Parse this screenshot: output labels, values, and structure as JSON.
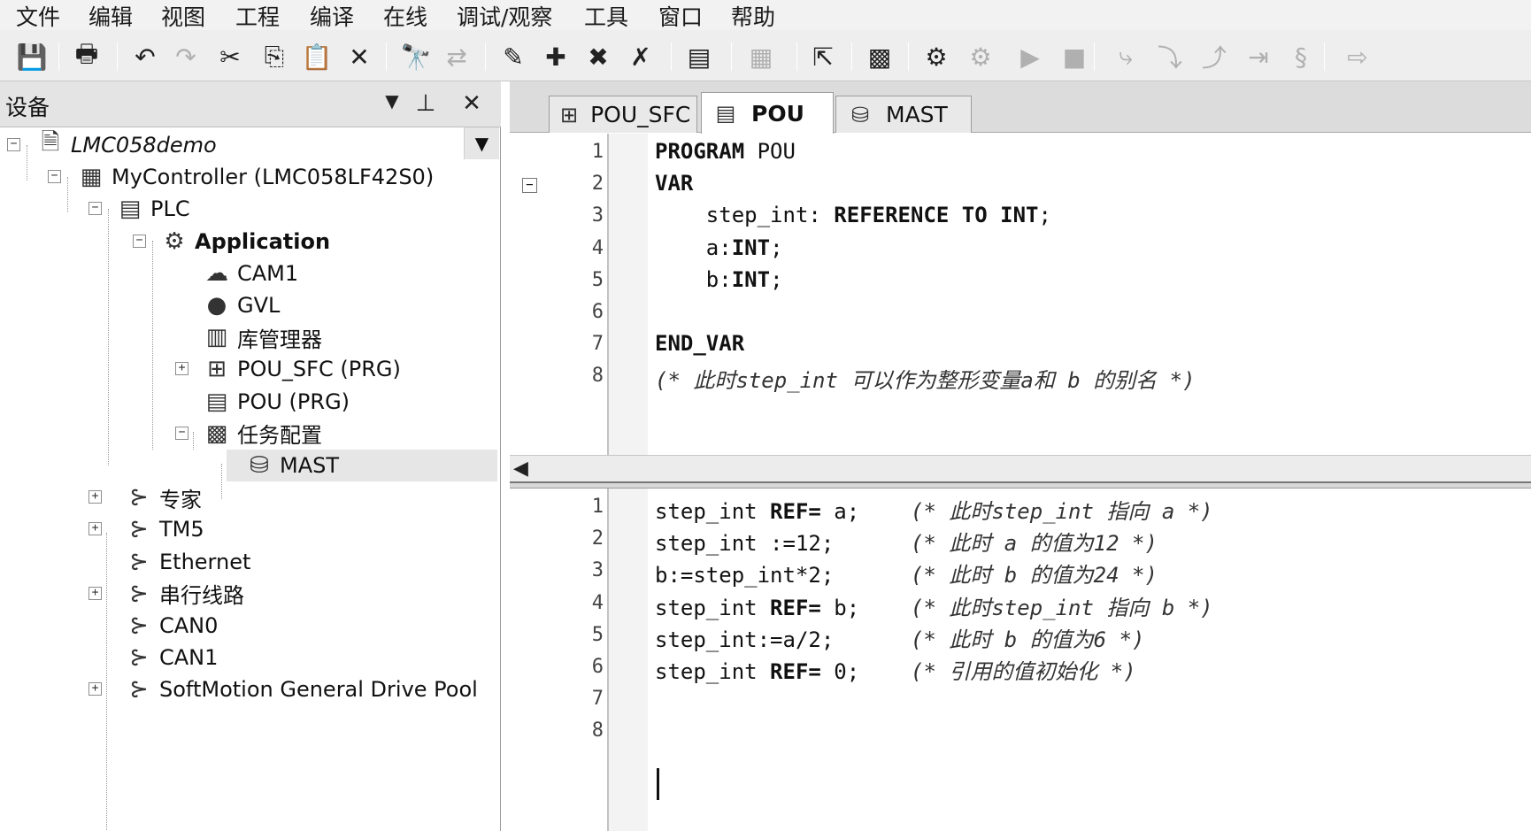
{
  "menu": [
    "文件",
    "编辑",
    "视图",
    "工程",
    "编译",
    "在线",
    "调试/观察",
    "工具",
    "窗口",
    "帮助"
  ],
  "toolbar": {
    "icons": [
      {
        "name": "save-icon",
        "glyph": "💾",
        "enabled": true
      },
      {
        "name": "print-icon",
        "glyph": "🖶",
        "enabled": true
      },
      {
        "name": "undo-icon",
        "glyph": "↶",
        "enabled": true
      },
      {
        "name": "redo-icon",
        "glyph": "↷",
        "enabled": false
      },
      {
        "name": "cut-icon",
        "glyph": "✂",
        "enabled": true
      },
      {
        "name": "copy-icon",
        "glyph": "⎘",
        "enabled": true
      },
      {
        "name": "paste-icon",
        "glyph": "📋",
        "enabled": true
      },
      {
        "name": "delete-icon",
        "glyph": "✕",
        "enabled": true
      },
      {
        "name": "find-icon",
        "glyph": "🔭",
        "enabled": true
      },
      {
        "name": "replace-icon",
        "glyph": "⇄",
        "enabled": false
      },
      {
        "name": "breakpoint-icon",
        "glyph": "✎",
        "enabled": true
      },
      {
        "name": "breakpoint-add-icon",
        "glyph": "✚",
        "enabled": true
      },
      {
        "name": "breakpoint-remove-icon",
        "glyph": "✖",
        "enabled": true
      },
      {
        "name": "breakpoint-toggle-icon",
        "glyph": "✗",
        "enabled": true
      },
      {
        "name": "device-icon",
        "glyph": "▤",
        "enabled": true
      },
      {
        "name": "insert-dropdown-icon",
        "glyph": "▦",
        "enabled": false
      },
      {
        "name": "export-icon",
        "glyph": "⇱",
        "enabled": true
      },
      {
        "name": "build-icon",
        "glyph": "▩",
        "enabled": true
      },
      {
        "name": "login-icon",
        "glyph": "⚙",
        "enabled": true
      },
      {
        "name": "logout-icon",
        "glyph": "⚙",
        "enabled": false
      },
      {
        "name": "run-icon",
        "glyph": "▶",
        "enabled": false
      },
      {
        "name": "stop-icon",
        "glyph": "■",
        "enabled": false
      },
      {
        "name": "step-over-icon",
        "glyph": "⤷",
        "enabled": false
      },
      {
        "name": "step-into-icon",
        "glyph": "⤵",
        "enabled": false
      },
      {
        "name": "step-out-icon",
        "glyph": "⤴",
        "enabled": false
      },
      {
        "name": "run-to-cursor-icon",
        "glyph": "⇥",
        "enabled": false
      },
      {
        "name": "reset-icon",
        "glyph": "§",
        "enabled": false
      },
      {
        "name": "next-statement-icon",
        "glyph": "⇨",
        "enabled": false
      }
    ]
  },
  "device_panel": {
    "title": "设备",
    "dropdown_glyph": "▼",
    "pin_glyph": "⊥",
    "close_glyph": "✕",
    "tree": [
      {
        "label": "LMC058demo",
        "icon": "project-icon",
        "glyph": "🗎",
        "toggle": "−",
        "style": "italic"
      },
      {
        "label": "MyController (LMC058LF42S0)",
        "icon": "controller-icon",
        "glyph": "▦",
        "toggle": "−",
        "style": "normal"
      },
      {
        "label": "PLC",
        "icon": "plc-logic-icon",
        "glyph": "▤",
        "toggle": "−",
        "style": "normal"
      },
      {
        "label": "Application",
        "icon": "application-gear-icon",
        "glyph": "⚙",
        "toggle": "−",
        "style": "bold"
      },
      {
        "label": "CAM1",
        "icon": "cam-icon",
        "glyph": "☁",
        "toggle": "",
        "style": "normal"
      },
      {
        "label": "GVL",
        "icon": "gvl-globe-icon",
        "glyph": "●",
        "toggle": "",
        "style": "normal"
      },
      {
        "label": "库管理器",
        "icon": "library-manager-icon",
        "glyph": "▥",
        "toggle": "",
        "style": "normal"
      },
      {
        "label": "POU_SFC (PRG)",
        "icon": "sfc-pou-icon",
        "glyph": "⊞",
        "toggle": "+",
        "style": "normal"
      },
      {
        "label": "POU (PRG)",
        "icon": "pou-document-icon",
        "glyph": "▤",
        "toggle": "",
        "style": "normal"
      },
      {
        "label": "任务配置",
        "icon": "task-config-icon",
        "glyph": "▩",
        "toggle": "−",
        "style": "normal"
      },
      {
        "label": "MAST",
        "icon": "task-mast-icon",
        "glyph": "⛁",
        "toggle": "",
        "style": "normal"
      },
      {
        "label": "专家",
        "icon": "expert-connector-icon",
        "glyph": "⊱",
        "toggle": "+",
        "style": "normal"
      },
      {
        "label": "TM5",
        "icon": "tm5-connector-icon",
        "glyph": "⊱",
        "toggle": "+",
        "style": "normal"
      },
      {
        "label": "Ethernet",
        "icon": "ethernet-connector-icon",
        "glyph": "⊱",
        "toggle": "",
        "style": "normal"
      },
      {
        "label": "串行线路",
        "icon": "serial-line-connector-icon",
        "glyph": "⊱",
        "toggle": "+",
        "style": "normal"
      },
      {
        "label": "CAN0",
        "icon": "can0-connector-icon",
        "glyph": "⊱",
        "toggle": "",
        "style": "normal"
      },
      {
        "label": "CAN1",
        "icon": "can1-connector-icon",
        "glyph": "⊱",
        "toggle": "",
        "style": "normal"
      },
      {
        "label": "SoftMotion General Drive Pool",
        "icon": "drive-pool-connector-icon",
        "glyph": "⊱",
        "toggle": "+",
        "style": "normal"
      }
    ],
    "selected_index": 10
  },
  "editor": {
    "tabs": [
      {
        "label": "POU_SFC",
        "icon": "sfc-pou-icon",
        "glyph": "⊞",
        "active": false
      },
      {
        "label": "POU",
        "icon": "pou-document-icon",
        "glyph": "▤",
        "active": true
      },
      {
        "label": "MAST",
        "icon": "task-mast-icon",
        "glyph": "⛁",
        "active": false
      }
    ],
    "declaration": {
      "line_numbers": [
        "1",
        "2",
        "3",
        "4",
        "5",
        "6",
        "7",
        "8"
      ],
      "fold_glyph": "−",
      "lines": [
        [
          {
            "t": "PROGRAM",
            "k": "kw"
          },
          {
            "t": " POU",
            "k": ""
          }
        ],
        [
          {
            "t": "VAR",
            "k": "kw"
          }
        ],
        [
          {
            "t": "    step_int: ",
            "k": ""
          },
          {
            "t": "REFERENCE TO INT",
            "k": "kw"
          },
          {
            "t": ";",
            "k": ""
          }
        ],
        [
          {
            "t": "    a:",
            "k": ""
          },
          {
            "t": "INT",
            "k": "kw"
          },
          {
            "t": ";",
            "k": ""
          }
        ],
        [
          {
            "t": "    b:",
            "k": ""
          },
          {
            "t": "INT",
            "k": "kw"
          },
          {
            "t": ";",
            "k": ""
          }
        ],
        [],
        [
          {
            "t": "END_VAR",
            "k": "kw"
          }
        ],
        [
          {
            "t": "(* 此时step_int 可以作为整形变量a和 b 的别名 *)",
            "k": "cm"
          }
        ]
      ]
    },
    "hscroll_arrow": "◀",
    "implementation": {
      "line_numbers": [
        "1",
        "2",
        "3",
        "4",
        "5",
        "6",
        "7",
        "8"
      ],
      "lines": [
        [
          {
            "t": "step_int ",
            "k": ""
          },
          {
            "t": "REF=",
            "k": "kw"
          },
          {
            "t": " a;    ",
            "k": ""
          },
          {
            "t": "(* 此时step_int 指向 a *)",
            "k": "cm"
          }
        ],
        [
          {
            "t": "step_int :=12;      ",
            "k": ""
          },
          {
            "t": "(* 此时 a 的值为12 *)",
            "k": "cm"
          }
        ],
        [
          {
            "t": "b:=step_int*2;      ",
            "k": ""
          },
          {
            "t": "(* 此时 b 的值为24 *)",
            "k": "cm"
          }
        ],
        [
          {
            "t": "step_int ",
            "k": ""
          },
          {
            "t": "REF=",
            "k": "kw"
          },
          {
            "t": " b;    ",
            "k": ""
          },
          {
            "t": "(* 此时step_int 指向 b *)",
            "k": "cm"
          }
        ],
        [
          {
            "t": "step_int:=a/2;      ",
            "k": ""
          },
          {
            "t": "(* 此时 b 的值为6 *)",
            "k": "cm"
          }
        ],
        [
          {
            "t": "step_int ",
            "k": ""
          },
          {
            "t": "REF=",
            "k": "kw"
          },
          {
            "t": " 0;    ",
            "k": ""
          },
          {
            "t": "(* 引用的值初始化 *)",
            "k": "cm"
          }
        ],
        [],
        []
      ]
    }
  }
}
